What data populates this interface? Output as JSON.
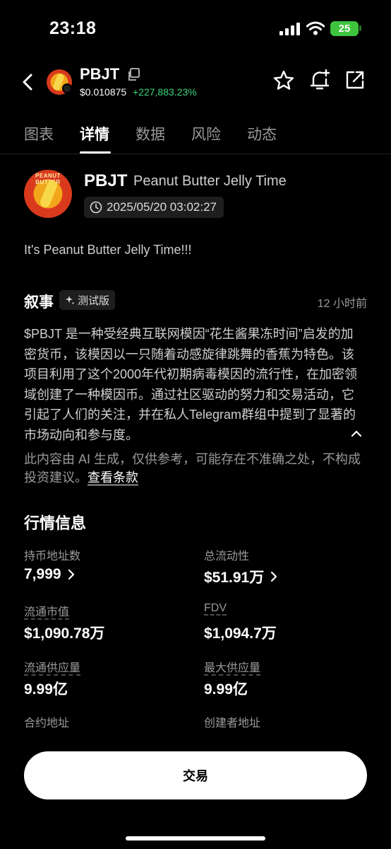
{
  "status_bar": {
    "time": "23:18",
    "battery": "25"
  },
  "header": {
    "symbol": "PBJT",
    "price": "$0.010875",
    "change": "+227,883.23%",
    "colors": {
      "positive": "#37d67a"
    },
    "icons": [
      "back-icon",
      "copy-icon",
      "star-icon",
      "alert-add-icon",
      "share-icon"
    ]
  },
  "tabs": [
    {
      "label": "图表",
      "active": false
    },
    {
      "label": "详情",
      "active": true
    },
    {
      "label": "数据",
      "active": false
    },
    {
      "label": "风险",
      "active": false
    },
    {
      "label": "动态",
      "active": false
    }
  ],
  "token": {
    "symbol": "PBJT",
    "full_name": "Peanut Butter Jelly Time",
    "created_at": "2025/05/20 03:02:27",
    "logo_text": "PEANUT BUTTER JELLY TIME"
  },
  "tagline": "It's Peanut Butter Jelly Time!!!",
  "narrative": {
    "title": "叙事",
    "badge": "测试版",
    "time_ago": "12 小时前",
    "body": "$PBJT 是一种受经典互联网模因“花生酱果冻时间”启发的加密货币，该模因以一只随着动感旋律跳舞的香蕉为特色。该项目利用了这个2000年代初期病毒模因的流行性，在加密领域创建了一种模因币。通过社区驱动的努力和交易活动，它引起了人们的关注，并在私人Telegram群组中提到了显著的市场动向和参与度。",
    "disclaimer": "此内容由 AI 生成，仅供参考，可能存在不准确之处，不构成投资建议。",
    "terms_link": "查看条款"
  },
  "market": {
    "title": "行情信息",
    "holders": {
      "label": "持币地址数",
      "value": "7,999"
    },
    "liquidity": {
      "label": "总流动性",
      "value": "$51.91万"
    },
    "market_cap": {
      "label": "流通市值",
      "value": "$1,090.78万"
    },
    "fdv": {
      "label": "FDV",
      "value": "$1,094.7万"
    },
    "circulating_supply": {
      "label": "流通供应量",
      "value": "9.99亿"
    },
    "max_supply": {
      "label": "最大供应量",
      "value": "9.99亿"
    },
    "contract_address": {
      "label": "合约地址"
    },
    "creator_address": {
      "label": "创建者地址"
    }
  },
  "trade_button": "交易"
}
